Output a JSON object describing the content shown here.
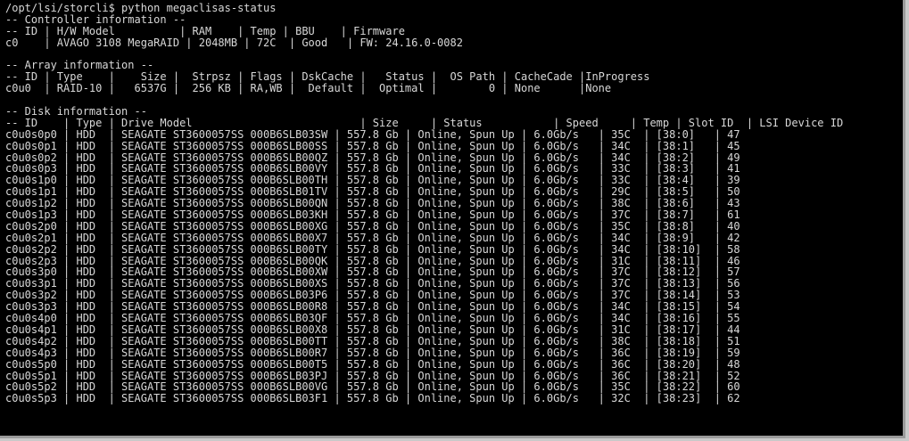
{
  "terminal": {
    "background": "#000000",
    "foreground": "#d8d8d8",
    "lines": [
      "/opt/lsi/storcli$ python megaclisas-status",
      "-- Controller information --",
      "-- ID | H/W Model          | RAM    | Temp | BBU    | Firmware",
      "c0    | AVAGO 3108 MegaRAID | 2048MB | 72C  | Good   | FW: 24.16.0-0082",
      "",
      "-- Array information --",
      "-- ID | Type    |    Size |  Strpsz | Flags | DskCache |   Status |  OS Path | CacheCade |InProgress",
      "c0u0  | RAID-10 |   6537G |  256 KB | RA,WB |  Default |  Optimal |        0 | None      |None",
      "",
      "-- Disk information --",
      "-- ID    | Type | Drive Model                          | Size     | Status           | Speed     | Temp | Slot ID  | LSI Device ID",
      "c0u0s0p0 | HDD  | SEAGATE ST3600057SS 000B6SLB03SW | 557.8 Gb | Online, Spun Up | 6.0Gb/s   | 35C  | [38:0]   | 47",
      "c0u0s0p1 | HDD  | SEAGATE ST3600057SS 000B6SLB00SS | 557.8 Gb | Online, Spun Up | 6.0Gb/s   | 34C  | [38:1]   | 45",
      "c0u0s0p2 | HDD  | SEAGATE ST3600057SS 000B6SLB00QZ | 557.8 Gb | Online, Spun Up | 6.0Gb/s   | 34C  | [38:2]   | 49",
      "c0u0s0p3 | HDD  | SEAGATE ST3600057SS 000B6SLB00VY | 557.8 Gb | Online, Spun Up | 6.0Gb/s   | 33C  | [38:3]   | 41",
      "c0u0s1p0 | HDD  | SEAGATE ST3600057SS 000B6SLB00TH | 557.8 Gb | Online, Spun Up | 6.0Gb/s   | 33C  | [38:4]   | 39",
      "c0u0s1p1 | HDD  | SEAGATE ST3600057SS 000B6SLB01TV | 557.8 Gb | Online, Spun Up | 6.0Gb/s   | 29C  | [38:5]   | 50",
      "c0u0s1p2 | HDD  | SEAGATE ST3600057SS 000B6SLB00QN | 557.8 Gb | Online, Spun Up | 6.0Gb/s   | 38C  | [38:6]   | 43",
      "c0u0s1p3 | HDD  | SEAGATE ST3600057SS 000B6SLB03KH | 557.8 Gb | Online, Spun Up | 6.0Gb/s   | 37C  | [38:7]   | 61",
      "c0u0s2p0 | HDD  | SEAGATE ST3600057SS 000B6SLB00XG | 557.8 Gb | Online, Spun Up | 6.0Gb/s   | 35C  | [38:8]   | 40",
      "c0u0s2p1 | HDD  | SEAGATE ST3600057SS 000B6SLB00X7 | 557.8 Gb | Online, Spun Up | 6.0Gb/s   | 34C  | [38:9]   | 42",
      "c0u0s2p2 | HDD  | SEAGATE ST3600057SS 000B6SLB00TY | 557.8 Gb | Online, Spun Up | 6.0Gb/s   | 34C  | [38:10]  | 58",
      "c0u0s2p3 | HDD  | SEAGATE ST3600057SS 000B6SLB00QK | 557.8 Gb | Online, Spun Up | 6.0Gb/s   | 31C  | [38:11]  | 46",
      "c0u0s3p0 | HDD  | SEAGATE ST3600057SS 000B6SLB00XW | 557.8 Gb | Online, Spun Up | 6.0Gb/s   | 37C  | [38:12]  | 57",
      "c0u0s3p1 | HDD  | SEAGATE ST3600057SS 000B6SLB00XS | 557.8 Gb | Online, Spun Up | 6.0Gb/s   | 37C  | [38:13]  | 56",
      "c0u0s3p2 | HDD  | SEAGATE ST3600057SS 000B6SLB03P6 | 557.8 Gb | Online, Spun Up | 6.0Gb/s   | 37C  | [38:14]  | 53",
      "c0u0s3p3 | HDD  | SEAGATE ST3600057SS 000B6SLB00R8 | 557.8 Gb | Online, Spun Up | 6.0Gb/s   | 34C  | [38:15]  | 54",
      "c0u0s4p0 | HDD  | SEAGATE ST3600057SS 000B6SLB03QF | 557.8 Gb | Online, Spun Up | 6.0Gb/s   | 34C  | [38:16]  | 55",
      "c0u0s4p1 | HDD  | SEAGATE ST3600057SS 000B6SLB00X8 | 557.8 Gb | Online, Spun Up | 6.0Gb/s   | 31C  | [38:17]  | 44",
      "c0u0s4p2 | HDD  | SEAGATE ST3600057SS 000B6SLB00TT | 557.8 Gb | Online, Spun Up | 6.0Gb/s   | 38C  | [38:18]  | 51",
      "c0u0s4p3 | HDD  | SEAGATE ST3600057SS 000B6SLB00R7 | 557.8 Gb | Online, Spun Up | 6.0Gb/s   | 36C  | [38:19]  | 59",
      "c0u0s5p0 | HDD  | SEAGATE ST3600057SS 000B6SLB00T5 | 557.8 Gb | Online, Spun Up | 6.0Gb/s   | 36C  | [38:20]  | 48",
      "c0u0s5p1 | HDD  | SEAGATE ST3600057SS 000B6SLB03PJ | 557.8 Gb | Online, Spun Up | 6.0Gb/s   | 36C  | [38:21]  | 52",
      "c0u0s5p2 | HDD  | SEAGATE ST3600057SS 000B6SLB00VG | 557.8 Gb | Online, Spun Up | 6.0Gb/s   | 35C  | [38:22]  | 60",
      "c0u0s5p3 | HDD  | SEAGATE ST3600057SS 000B6SLB03F1 | 557.8 Gb | Online, Spun Up | 6.0Gb/s   | 32C  | [38:23]  | 62"
    ]
  }
}
